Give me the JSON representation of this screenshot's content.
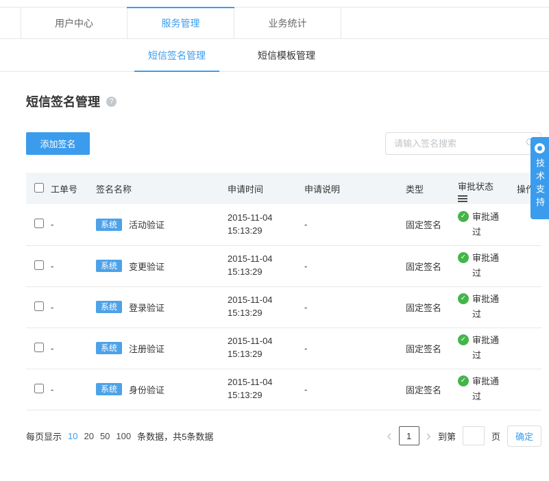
{
  "colors": {
    "accent": "#3B9CED",
    "badge": "#4DA2E8",
    "success": "#44B549"
  },
  "top_tabs": [
    {
      "label": "用户中心"
    },
    {
      "label": "服务管理"
    },
    {
      "label": "业务统计"
    }
  ],
  "sub_tabs": [
    {
      "label": "短信签名管理"
    },
    {
      "label": "短信模板管理"
    }
  ],
  "page_title": "短信签名管理",
  "help_icon": "?",
  "toolbar": {
    "add_button": "添加签名",
    "search_placeholder": "请输入签名搜索"
  },
  "support": {
    "label": "技术支持"
  },
  "table": {
    "headers": {
      "order": "工单号",
      "name": "签名名称",
      "time": "申请时间",
      "desc": "申请说明",
      "type": "类型",
      "status": "审批状态",
      "action": "操作"
    },
    "rows": [
      {
        "order": "-",
        "badge": "系统",
        "name": "活动验证",
        "time": "2015-11-04 15:13:29",
        "desc": "-",
        "type": "固定签名",
        "status": "审批通过"
      },
      {
        "order": "-",
        "badge": "系统",
        "name": "变更验证",
        "time": "2015-11-04 15:13:29",
        "desc": "-",
        "type": "固定签名",
        "status": "审批通过"
      },
      {
        "order": "-",
        "badge": "系统",
        "name": "登录验证",
        "time": "2015-11-04 15:13:29",
        "desc": "-",
        "type": "固定签名",
        "status": "审批通过"
      },
      {
        "order": "-",
        "badge": "系统",
        "name": "注册验证",
        "time": "2015-11-04 15:13:29",
        "desc": "-",
        "type": "固定签名",
        "status": "审批通过"
      },
      {
        "order": "-",
        "badge": "系统",
        "name": "身份验证",
        "time": "2015-11-04 15:13:29",
        "desc": "-",
        "type": "固定签名",
        "status": "审批通过"
      }
    ]
  },
  "pagination": {
    "per_page_label": "每页显示",
    "sizes": [
      "10",
      "20",
      "50",
      "100"
    ],
    "active_size": "10",
    "data_label": "条数据，共5条数据",
    "prev": "‹",
    "next": "›",
    "current_page": "1",
    "goto_label": "到第",
    "page_unit": "页",
    "confirm_button": "确定"
  }
}
